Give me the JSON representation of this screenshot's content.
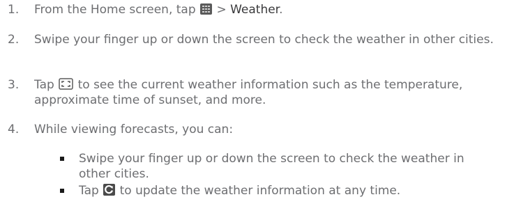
{
  "steps": [
    {
      "number": "1.",
      "before_icon": "From the Home screen, tap",
      "icon": "all-apps-grid-icon",
      "after_icon": ">",
      "emphasis": "Weather",
      "end": "."
    },
    {
      "number": "2.",
      "text": "Swipe your finger up or down the screen to check the weather in other cities."
    },
    {
      "number": "3.",
      "before_icon": "Tap",
      "icon": "expand-frame-icon",
      "after_icon": "to see the current weather information such as the temperature, approximate time of sunset, and more."
    },
    {
      "number": "4.",
      "text": "While viewing forecasts, you can:"
    }
  ],
  "substeps": [
    {
      "text": "Swipe your finger up or down the screen to check the weather in other cities."
    },
    {
      "before_icon": "Tap",
      "icon": "refresh-icon",
      "after_icon": "to update the weather information at any time."
    }
  ],
  "colors": {
    "body_text": "#6d6e71",
    "emphasis_text": "#3a3a3c",
    "bullet": "#1a1a1a",
    "icon_fill": "#5a5a5a"
  }
}
